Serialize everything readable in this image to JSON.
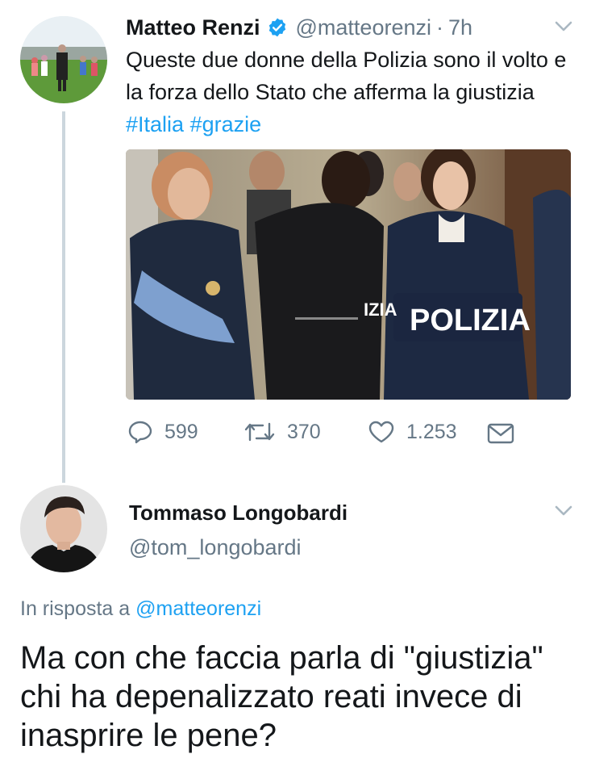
{
  "tweet": {
    "author_name": "Matteo Renzi",
    "handle": "@matteorenzi",
    "separator": "·",
    "time": "7h",
    "text_main": "Queste due donne della Polizia sono il volto e la forza dello Stato che afferma la giustizia ",
    "hashtags": [
      "#Italia",
      "#grazie"
    ],
    "photo_vest_text": "POLIZIA",
    "photo_vest_text_left": "IZIA",
    "actions": {
      "replies": "599",
      "retweets": "370",
      "likes": "1.253"
    },
    "verified": true
  },
  "reply": {
    "author_name": "Tommaso Longobardi",
    "handle": "@tom_longobardi",
    "in_reply_prefix": "In risposta a",
    "in_reply_handle": "@matteorenzi",
    "text": "Ma con che faccia parla di \"giustizia\" chi ha depenalizzato reati invece di inasprire le pene?"
  },
  "colors": {
    "accent": "#1da1f2",
    "secondary_text": "#657786",
    "thread_line": "#ccd6dd"
  },
  "icons": [
    "reply-icon",
    "retweet-icon",
    "like-icon",
    "dm-icon",
    "chevron-down-icon",
    "verified-badge-icon"
  ]
}
